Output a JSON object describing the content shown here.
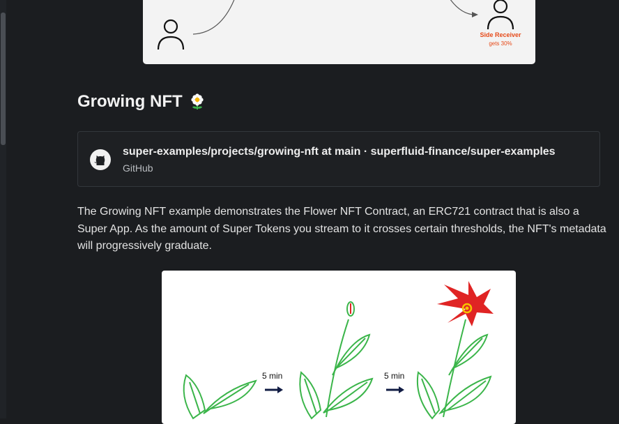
{
  "top_diagram": {
    "receiver_label": "Side Receiver",
    "receiver_share": "gets 30%",
    "accent_color": "#e64a19"
  },
  "section": {
    "heading": "Growing NFT",
    "heading_icon": "flower-icon"
  },
  "embed": {
    "title": "super-examples/projects/growing-nft at main · superfluid-finance/super-examples",
    "provider": "GitHub",
    "icon": "github-icon"
  },
  "paragraph": {
    "text": "The Growing NFT example demonstrates the Flower NFT Contract, an ERC721 contract that is also a Super App. As the amount of Super Tokens you stream to it crosses certain thresholds, the NFT's metadata will progressively graduate."
  },
  "growth_figure": {
    "step1_label": "5 min",
    "step2_label": "5 min",
    "flower_color": "#e02424",
    "stem_color": "#3bb54a"
  },
  "colors": {
    "background": "#1b1d20",
    "card_border": "#33373c",
    "text": "#e3e3e3"
  }
}
